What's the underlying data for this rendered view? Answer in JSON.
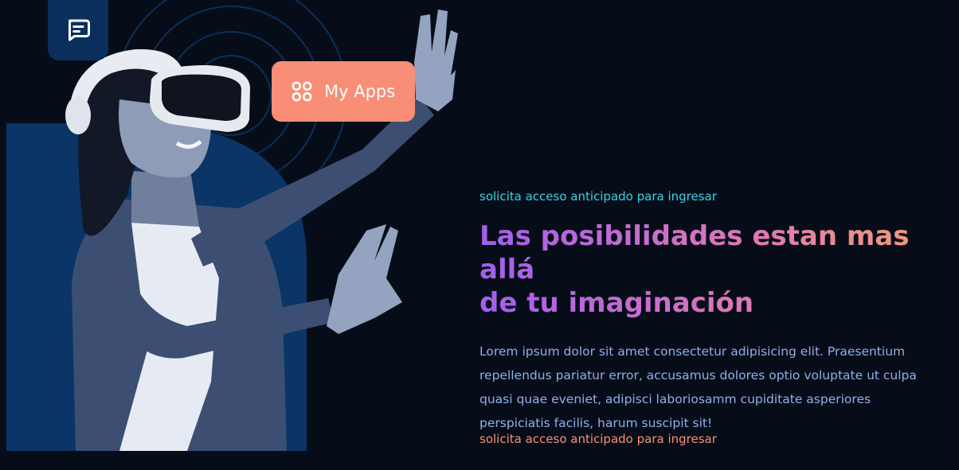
{
  "hero": {
    "apps_button_label": "My Apps",
    "chat_icon": "chat-icon",
    "apps_icon": "grid-apps-icon"
  },
  "content": {
    "eyebrow": "solicita acceso anticipado para ingresar",
    "headline_line1": "Las posibilidades estan mas allá",
    "headline_line2": "de tu imaginación",
    "body": "Lorem ipsum dolor sit amet consectetur adipisicing elit. Praesentium repellendus pariatur error, accusamus dolores optio voluptate ut culpa quasi quae eveniet, adipisci laboriosamm cupiditate asperiores perspiciatis facilis, harum suscipit sit!",
    "cta_link": "solicita acceso anticipado para ingresar"
  },
  "colors": {
    "background": "#070d18",
    "panel": "#0b2f5c",
    "accent_coral": "#f88e76",
    "accent_cyan": "#36d3e6",
    "gradient_start": "#a25ef0",
    "gradient_end": "#f49c74",
    "body_text": "#8fb0ec"
  }
}
